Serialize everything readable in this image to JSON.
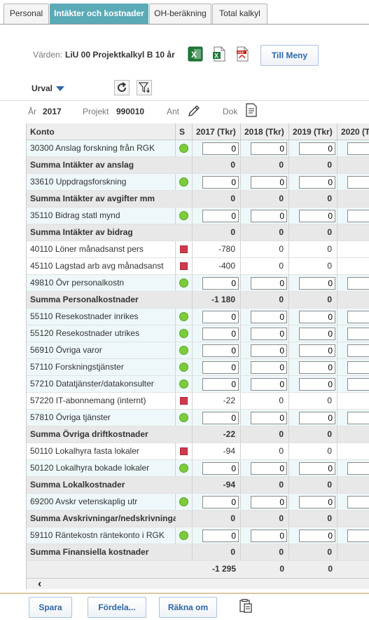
{
  "tabs": [
    {
      "label": "Personal",
      "active": false
    },
    {
      "label": "Intäkter och kostnader",
      "active": true
    },
    {
      "label": "OH-beräkning",
      "active": false
    },
    {
      "label": "Total kalkyl",
      "active": false
    }
  ],
  "header": {
    "varden_label": "Värden:",
    "varden_value": "LiU 00 Projektkalkyl B 10 år",
    "till_meny": "Till Meny",
    "urval": "Urval",
    "ar_label": "År",
    "ar_value": "2017",
    "projekt_label": "Projekt",
    "projekt_value": "990010",
    "ant_label": "Ant",
    "dok_label": "Dok"
  },
  "table": {
    "columns": [
      "Konto",
      "S",
      "2017 (Tkr)",
      "2018 (Tkr)",
      "2019 (Tkr)",
      "2020 (T"
    ],
    "rows": [
      {
        "konto": "30300 Anslag forskning från RGK",
        "type": "input",
        "status": "green",
        "vals": [
          "0",
          "0",
          "0",
          ""
        ]
      },
      {
        "konto": "Summa Intäkter av anslag",
        "type": "sum",
        "vals": [
          "0",
          "0",
          "0",
          ""
        ]
      },
      {
        "konto": "33610 Uppdragsforskning",
        "type": "input",
        "status": "green",
        "vals": [
          "0",
          "0",
          "0",
          ""
        ]
      },
      {
        "konto": "Summa Intäkter av avgifter mm",
        "type": "sum",
        "vals": [
          "0",
          "0",
          "0",
          ""
        ]
      },
      {
        "konto": "35110 Bidrag statl mynd",
        "type": "input",
        "status": "green",
        "vals": [
          "0",
          "0",
          "0",
          ""
        ]
      },
      {
        "konto": "Summa Intäkter av bidrag",
        "type": "sum",
        "vals": [
          "0",
          "0",
          "0",
          ""
        ]
      },
      {
        "konto": "40110 Löner månadsanst pers",
        "type": "text",
        "status": "red",
        "vals": [
          "-780",
          "0",
          "0",
          ""
        ]
      },
      {
        "konto": "45110 Lagstad arb avg månadsanst",
        "type": "text",
        "status": "red",
        "vals": [
          "-400",
          "0",
          "0",
          ""
        ]
      },
      {
        "konto": "49810 Övr personalkostn",
        "type": "input",
        "status": "green",
        "vals": [
          "0",
          "0",
          "0",
          ""
        ]
      },
      {
        "konto": "Summa Personalkostnader",
        "type": "sum",
        "vals": [
          "-1 180",
          "0",
          "0",
          ""
        ]
      },
      {
        "konto": "55110 Resekostnader inrikes",
        "type": "input",
        "status": "green",
        "vals": [
          "0",
          "0",
          "0",
          ""
        ]
      },
      {
        "konto": "55120 Resekostnader utrikes",
        "type": "input",
        "status": "green",
        "vals": [
          "0",
          "0",
          "0",
          ""
        ]
      },
      {
        "konto": "56910 Övriga varor",
        "type": "input",
        "status": "green",
        "vals": [
          "0",
          "0",
          "0",
          ""
        ]
      },
      {
        "konto": "57110 Forskningstjänster",
        "type": "input",
        "status": "green",
        "vals": [
          "0",
          "0",
          "0",
          ""
        ]
      },
      {
        "konto": "57210 Datatjänster/datakonsulter",
        "type": "input",
        "status": "green",
        "vals": [
          "0",
          "0",
          "0",
          ""
        ]
      },
      {
        "konto": "57220 IT-abonnemang (internt)",
        "type": "text",
        "status": "red",
        "vals": [
          "-22",
          "0",
          "0",
          ""
        ]
      },
      {
        "konto": "57810 Övriga tjänster",
        "type": "input",
        "status": "green",
        "vals": [
          "0",
          "0",
          "0",
          ""
        ]
      },
      {
        "konto": "Summa Övriga driftkostnader",
        "type": "sum",
        "vals": [
          "-22",
          "0",
          "0",
          ""
        ]
      },
      {
        "konto": "50110 Lokalhyra fasta lokaler",
        "type": "text",
        "status": "red",
        "vals": [
          "-94",
          "0",
          "0",
          ""
        ]
      },
      {
        "konto": "50120 Lokalhyra bokade lokaler",
        "type": "input",
        "status": "green",
        "vals": [
          "0",
          "0",
          "0",
          ""
        ]
      },
      {
        "konto": "Summa Lokalkostnader",
        "type": "sum",
        "vals": [
          "-94",
          "0",
          "0",
          ""
        ]
      },
      {
        "konto": "69200 Avskr vetenskaplig utr",
        "type": "input",
        "status": "green",
        "vals": [
          "0",
          "0",
          "0",
          ""
        ]
      },
      {
        "konto": "Summa Avskrivningar/nedskrivningar",
        "type": "sum",
        "vals": [
          "0",
          "0",
          "0",
          ""
        ]
      },
      {
        "konto": "59110 Räntekostn räntekonto i RGK",
        "type": "input",
        "status": "green",
        "vals": [
          "0",
          "0",
          "0",
          ""
        ]
      },
      {
        "konto": "Summa Finansiella kostnader",
        "type": "sum",
        "vals": [
          "0",
          "0",
          "0",
          ""
        ]
      }
    ],
    "totals": [
      "-1 295",
      "0",
      "0",
      ""
    ]
  },
  "footer": {
    "spara": "Spara",
    "fordela": "Fördela...",
    "rakna_om": "Räkna om"
  },
  "colors": {
    "tab_active": "#5aaab7",
    "status_green": "#7ccc3a",
    "status_red": "#d03a4c",
    "button_text": "#2e66a8"
  }
}
